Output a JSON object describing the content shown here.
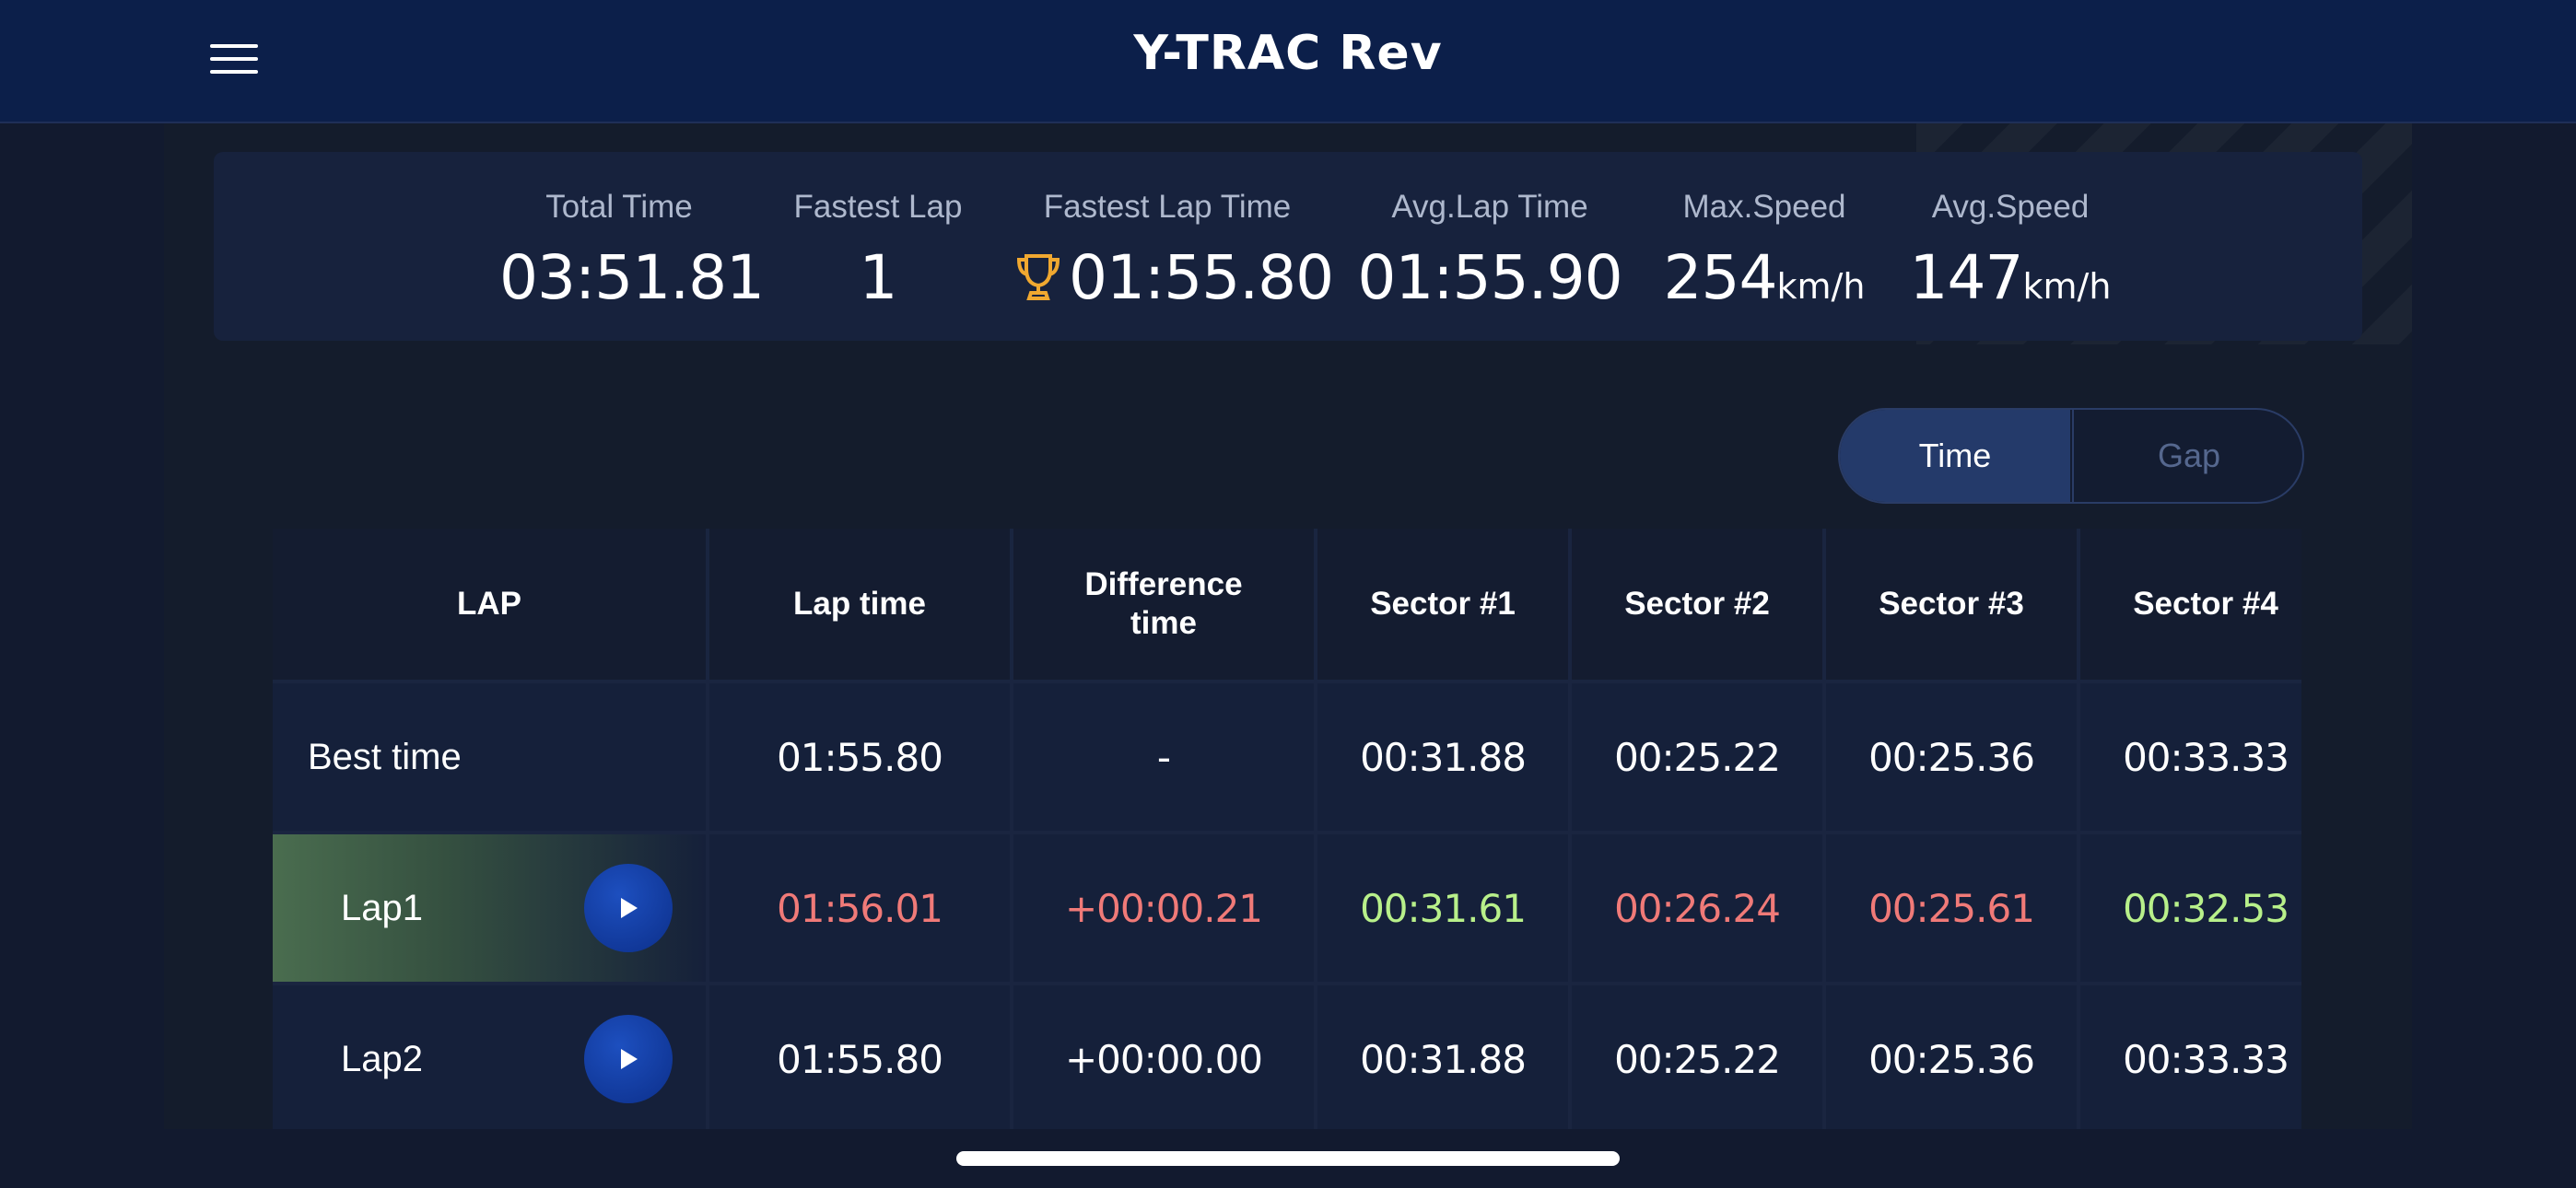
{
  "app": {
    "title": "Y-TRAC Rev",
    "menu_icon": "hamburger-icon"
  },
  "summary": {
    "total_time": {
      "label": "Total Time",
      "value": "03:51.81"
    },
    "fastest_lap": {
      "label": "Fastest Lap",
      "value": "1"
    },
    "fastest_lap_time": {
      "label": "Fastest Lap Time",
      "value": "01:55.80",
      "icon": "trophy-icon"
    },
    "avg_lap_time": {
      "label": "Avg.Lap Time",
      "value": "01:55.90"
    },
    "max_speed": {
      "label": "Max.Speed",
      "value": "254",
      "unit": "km/h"
    },
    "avg_speed": {
      "label": "Avg.Speed",
      "value": "147",
      "unit": "km/h"
    }
  },
  "toggle": {
    "options": [
      "Time",
      "Gap"
    ],
    "selected": "Time"
  },
  "table": {
    "headers": {
      "lap": "LAP",
      "lap_time": "Lap time",
      "difference_line1": "Difference",
      "difference_line2": "time",
      "sector1": "Sector #1",
      "sector2": "Sector #2",
      "sector3": "Sector #3",
      "sector4": "Sector #4"
    },
    "rows": [
      {
        "lap": "Best time",
        "lap_time": "01:55.80",
        "difference": "-",
        "sector1": "00:31.88",
        "sector2": "00:25.22",
        "sector3": "00:25.36",
        "sector4": "00:33.33"
      },
      {
        "lap": "Lap1",
        "lap_time": "01:56.01",
        "difference": "+00:00.21",
        "sector1": "00:31.61",
        "sector2": "00:26.24",
        "sector3": "00:25.61",
        "sector4": "00:32.53"
      },
      {
        "lap": "Lap2",
        "lap_time": "01:55.80",
        "difference": "+00:00.00",
        "sector1": "00:31.88",
        "sector2": "00:25.22",
        "sector3": "00:25.36",
        "sector4": "00:33.33"
      }
    ]
  },
  "colors": {
    "slower": "#f07a78",
    "faster": "#b8f08a",
    "trophy": "#f0a830"
  }
}
